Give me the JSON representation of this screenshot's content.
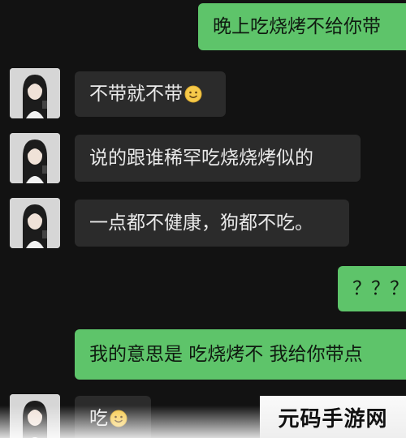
{
  "messages": [
    {
      "side": "out",
      "text": "晚上吃烧烤不给你带"
    },
    {
      "side": "in",
      "text": "不带就不带",
      "emoji": "smile-emoji"
    },
    {
      "side": "in",
      "text": "说的跟谁稀罕吃烧烧烤似的"
    },
    {
      "side": "in",
      "text": "一点都不健康，狗都不吃。"
    },
    {
      "side": "out",
      "text": "？？？"
    },
    {
      "side": "out",
      "text": "我的意思是 吃烧烤不 我给你带点"
    },
    {
      "side": "in",
      "text": "吃",
      "emoji": "smile-emoji"
    }
  ],
  "watermark": "元码手游网",
  "colors": {
    "background": "#121212",
    "outgoing_bubble": "#5ec46a",
    "incoming_bubble": "#2b2b2b"
  }
}
